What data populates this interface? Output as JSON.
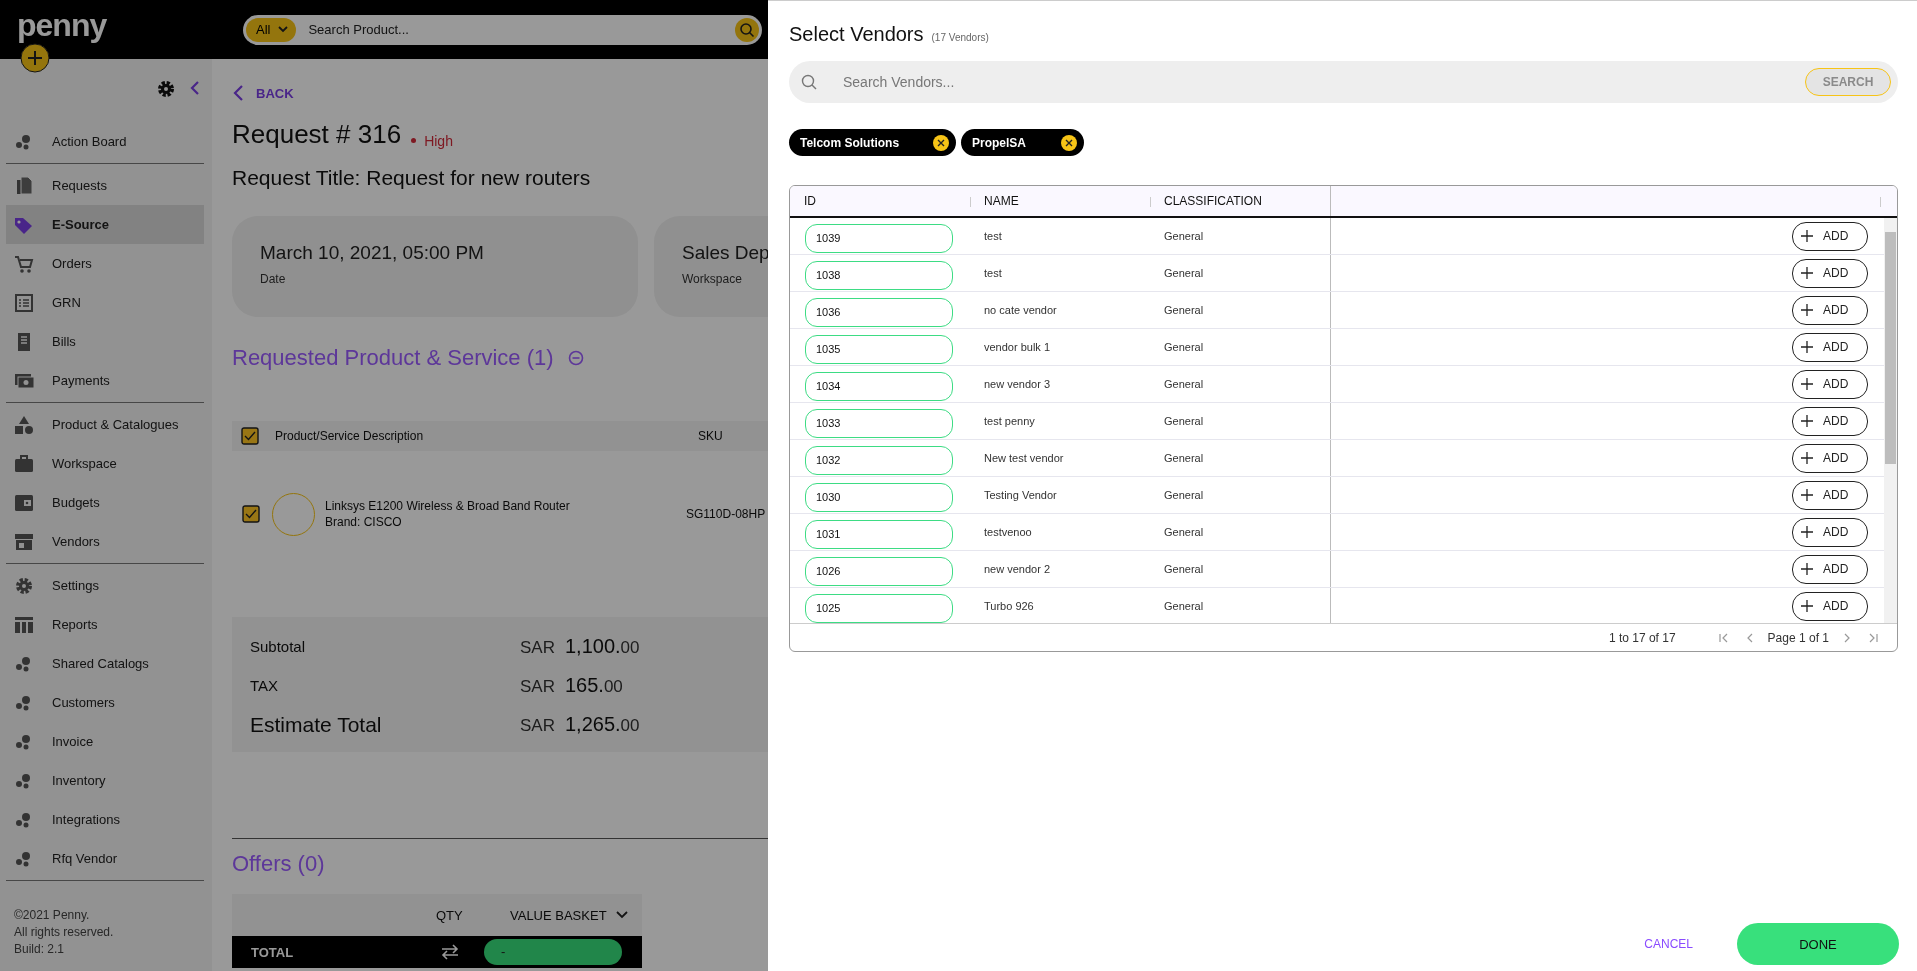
{
  "header": {
    "logo": "penny",
    "search": {
      "category": "All",
      "placeholder": "Search Product..."
    }
  },
  "sidebar": {
    "groups": [
      {
        "items": [
          {
            "label": "Action Board",
            "kind": "dots",
            "selected": false
          }
        ]
      },
      {
        "items": [
          {
            "label": "Requests",
            "kind": "document",
            "selected": false
          },
          {
            "label": "E-Source",
            "kind": "tag",
            "selected": true
          },
          {
            "label": "Orders",
            "kind": "cart",
            "selected": false
          },
          {
            "label": "GRN",
            "kind": "list",
            "selected": false
          },
          {
            "label": "Bills",
            "kind": "receipt",
            "selected": false
          },
          {
            "label": "Payments",
            "kind": "cash",
            "selected": false
          }
        ]
      },
      {
        "items": [
          {
            "label": "Product & Catalogues",
            "kind": "shapes",
            "selected": false
          },
          {
            "label": "Workspace",
            "kind": "briefcase",
            "selected": false
          },
          {
            "label": "Budgets",
            "kind": "wallet",
            "selected": false
          },
          {
            "label": "Vendors",
            "kind": "store",
            "selected": false
          }
        ]
      },
      {
        "items": [
          {
            "label": "Settings",
            "kind": "gear",
            "selected": false
          },
          {
            "label": "Reports",
            "kind": "columns",
            "selected": false
          },
          {
            "label": "Shared Catalogs",
            "kind": "dots",
            "selected": false
          },
          {
            "label": "Customers",
            "kind": "dots",
            "selected": false
          },
          {
            "label": "Invoice",
            "kind": "dots",
            "selected": false
          },
          {
            "label": "Inventory",
            "kind": "dots",
            "selected": false
          },
          {
            "label": "Integrations",
            "kind": "dots",
            "selected": false
          },
          {
            "label": "Rfq Vendor",
            "kind": "dots",
            "selected": false
          }
        ]
      }
    ],
    "footer": [
      "©2021 Penny.",
      "All rights reserved.",
      "Build: 2.1"
    ]
  },
  "main": {
    "back": "BACK",
    "title": "Request # 316",
    "priority": "High",
    "request_title": "Request Title: Request for new routers",
    "info_cards": [
      {
        "value": "March 10, 2021, 05:00 PM",
        "label": "Date"
      },
      {
        "value": "Sales Dep",
        "label": "Workspace"
      }
    ],
    "section_title": "Requested Product & Service (1)",
    "products": {
      "columns": [
        "Product/Service Description",
        "SKU"
      ],
      "all_checked": true,
      "rows": [
        {
          "checked": true,
          "description": "Linksys E1200 Wireless & Broad Band Router",
          "brand": "Brand: CISCO",
          "sku": "SG110D-08HP"
        }
      ]
    },
    "summary": [
      {
        "kind": "normal",
        "label": "Subtotal",
        "currency": "SAR",
        "whole": "1,100.",
        "decimals": "00"
      },
      {
        "kind": "normal",
        "label": "TAX",
        "currency": "SAR",
        "whole": "165.",
        "decimals": "00"
      },
      {
        "kind": "total",
        "label": "Estimate Total",
        "currency": "SAR",
        "whole": "1,265.",
        "decimals": "00"
      }
    ],
    "offers": {
      "title": "Offers (0)",
      "columns": [
        "QTY",
        "VALUE BASKET"
      ],
      "total_label": "TOTAL",
      "total_value": "-"
    }
  },
  "modal": {
    "title": "Select Vendors",
    "count": "(17 Vendors)",
    "search": {
      "placeholder": "Search Vendors...",
      "button": "SEARCH"
    },
    "chips": [
      "Telcom Solutions",
      "PropelSA"
    ],
    "columns": [
      "ID",
      "NAME",
      "CLASSIFICATION"
    ],
    "rows": [
      {
        "id": "1039",
        "name": "test",
        "classification": "General",
        "action": "ADD"
      },
      {
        "id": "1038",
        "name": "test",
        "classification": "General",
        "action": "ADD"
      },
      {
        "id": "1036",
        "name": "no cate vendor",
        "classification": "General",
        "action": "ADD"
      },
      {
        "id": "1035",
        "name": "vendor bulk 1",
        "classification": "General",
        "action": "ADD"
      },
      {
        "id": "1034",
        "name": "new vendor 3",
        "classification": "General",
        "action": "ADD"
      },
      {
        "id": "1033",
        "name": "test penny",
        "classification": "General",
        "action": "ADD"
      },
      {
        "id": "1032",
        "name": "New test vendor",
        "classification": "General",
        "action": "ADD"
      },
      {
        "id": "1030",
        "name": "Testing Vendor",
        "classification": "General",
        "action": "ADD"
      },
      {
        "id": "1031",
        "name": "testvenoo",
        "classification": "General",
        "action": "ADD"
      },
      {
        "id": "1026",
        "name": "new vendor 2",
        "classification": "General",
        "action": "ADD"
      },
      {
        "id": "1025",
        "name": "Turbo 926",
        "classification": "General",
        "action": "ADD"
      }
    ],
    "range": "1 to 17 of 17",
    "page": "Page 1 of 1",
    "cancel": "CANCEL",
    "done": "DONE"
  }
}
